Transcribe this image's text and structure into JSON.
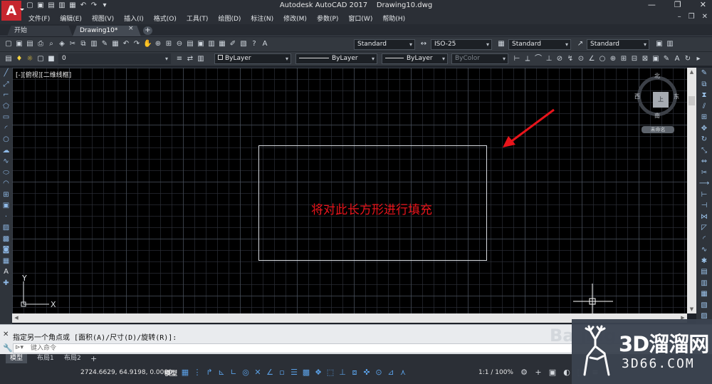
{
  "window": {
    "app_name": "Autodesk AutoCAD 2017",
    "file_name": "Drawing10.dwg",
    "app_logo": "A"
  },
  "quick_access": [
    "new",
    "open",
    "save",
    "saveas",
    "plot",
    "undo",
    "redo",
    "customize"
  ],
  "menu": {
    "items": [
      "文件(F)",
      "编辑(E)",
      "视图(V)",
      "插入(I)",
      "格式(O)",
      "工具(T)",
      "绘图(D)",
      "标注(N)",
      "修改(M)",
      "参数(P)",
      "窗口(W)",
      "帮助(H)"
    ]
  },
  "tabs": {
    "start": "开始",
    "drawing": "Drawing10*",
    "close_glyph": "×",
    "add_glyph": "+"
  },
  "toolbar1": {
    "text_style": "Standard",
    "dim_style": "ISO-25",
    "table_style": "Standard",
    "multileader_style": "Standard"
  },
  "toolbar2": {
    "layer_name": "0",
    "color": "ByLayer",
    "linetype": "ByLayer",
    "lineweight": "ByLayer",
    "plot_style": "ByColor"
  },
  "canvas": {
    "view_label": "[-][俯视][二维线框]",
    "annotation": "将对此长方形进行填充",
    "annotation_color": "#e8141b",
    "background": "#000000",
    "rect_color": "#d8dbe0",
    "ucs_x": "X",
    "ucs_y": "Y"
  },
  "viewcube": {
    "north": "北",
    "south": "南",
    "east": "东",
    "west": "西",
    "face": "上",
    "wcs": "未命名"
  },
  "command": {
    "history": "指定另一个角点或 [面积(A)/尺寸(D)/旋转(R)]:",
    "placeholder": "键入命令"
  },
  "layout_tabs": [
    "模型",
    "布局1",
    "布局2"
  ],
  "status": {
    "coordinates": "2724.6629, 64.9198, 0.0000",
    "model": "模型",
    "scale": "1:1 / 100%"
  },
  "watermark": {
    "brand": "3D溜溜网",
    "url": "3D66.COM",
    "partial": "Ba jing"
  }
}
